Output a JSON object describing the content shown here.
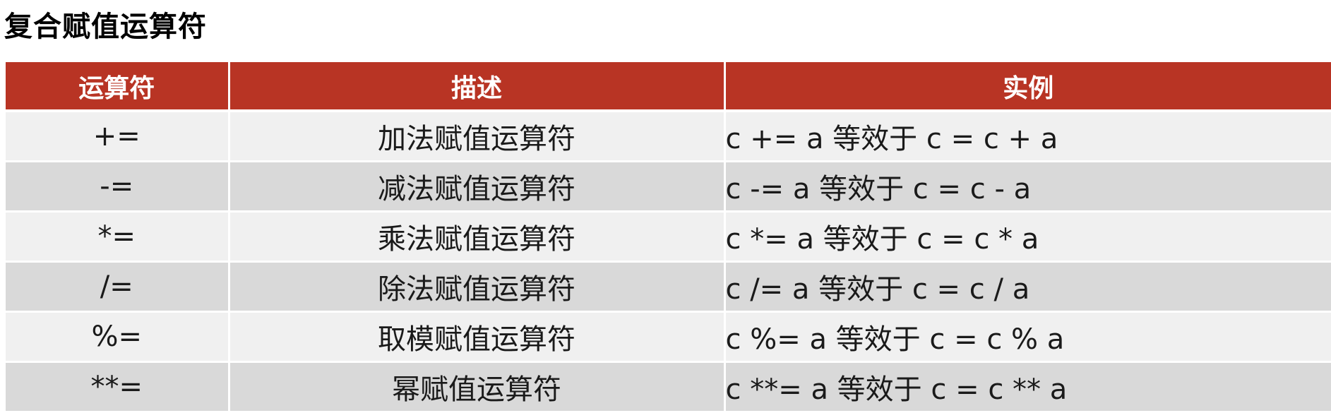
{
  "title": "复合赋值运算符",
  "table": {
    "headers": [
      "运算符",
      "描述",
      "实例"
    ],
    "rows": [
      {
        "operator": "+=",
        "description": "加法赋值运算符",
        "example": "c += a 等效于 c = c + a"
      },
      {
        "operator": "-=",
        "description": "减法赋值运算符",
        "example": "c -= a 等效于 c = c - a"
      },
      {
        "operator": "*=",
        "description": "乘法赋值运算符",
        "example": "c *= a 等效于 c = c * a"
      },
      {
        "operator": "/=",
        "description": "除法赋值运算符",
        "example": "c /= a 等效于 c = c / a"
      },
      {
        "operator": "%=",
        "description": "取模赋值运算符",
        "example": "c %= a 等效于 c = c % a"
      },
      {
        "operator": "**=",
        "description": "幂赋值运算符",
        "example": "c **= a 等效于 c = c ** a"
      }
    ]
  },
  "colors": {
    "header_bg": "#b83424",
    "row_light": "#f0f0f0",
    "row_dark": "#d9d9d9"
  }
}
